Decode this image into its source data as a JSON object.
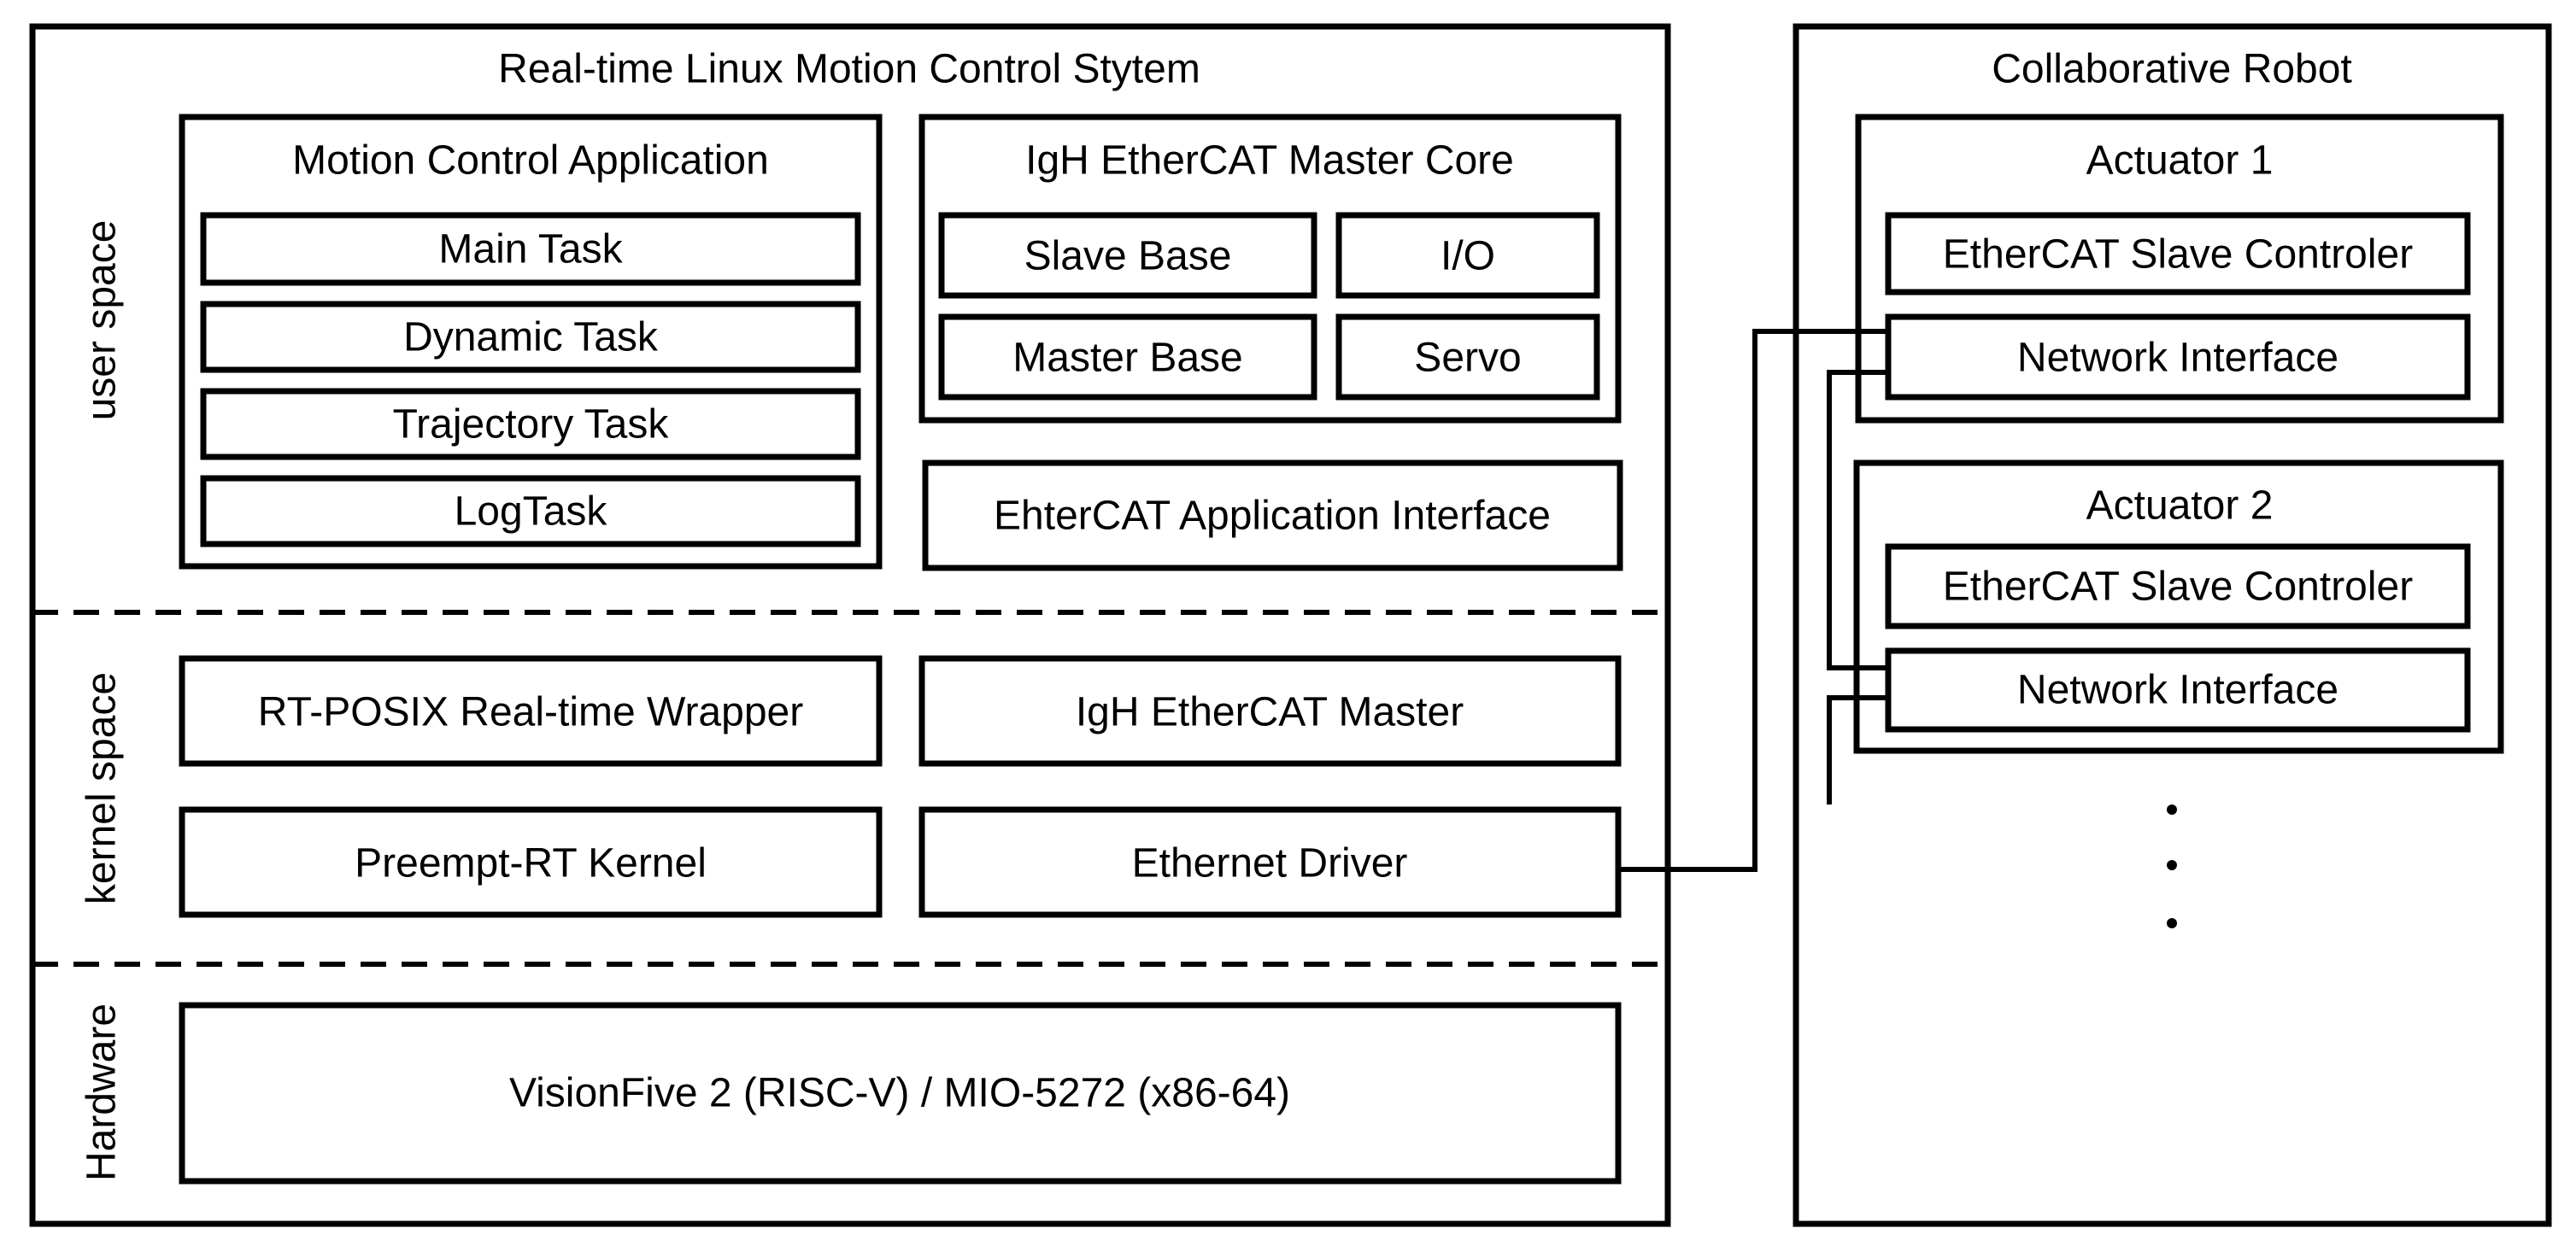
{
  "system": {
    "title": "Real-time Linux Motion Control Stytem",
    "layers": {
      "user": "user space",
      "kernel": "kernel space",
      "hardware": "Hardware"
    },
    "motion_app": {
      "title": "Motion Control Application",
      "tasks": [
        "Main Task",
        "Dynamic Task",
        "Trajectory Task",
        "LogTask"
      ]
    },
    "igh_core": {
      "title": "IgH EtherCAT Master Core",
      "items": [
        "Slave Base",
        "I/O",
        "Master Base",
        "Servo"
      ]
    },
    "app_interface": "EhterCAT Application Interface",
    "kernel": {
      "rt_posix": "RT-POSIX Real-time Wrapper",
      "igh_master": "IgH EtherCAT Master",
      "preempt": "Preempt-RT Kernel",
      "ethernet": "Ethernet Driver"
    },
    "hardware": "VisionFive 2 (RISC-V) / MIO-5272 (x86-64)"
  },
  "robot": {
    "title": "Collaborative Robot",
    "actuators": [
      {
        "title": "Actuator 1",
        "controller": "EtherCAT Slave Controler",
        "network": "Network Interface"
      },
      {
        "title": "Actuator 2",
        "controller": "EtherCAT Slave Controler",
        "network": "Network Interface"
      }
    ],
    "continuation": "vertical-ellipsis"
  }
}
